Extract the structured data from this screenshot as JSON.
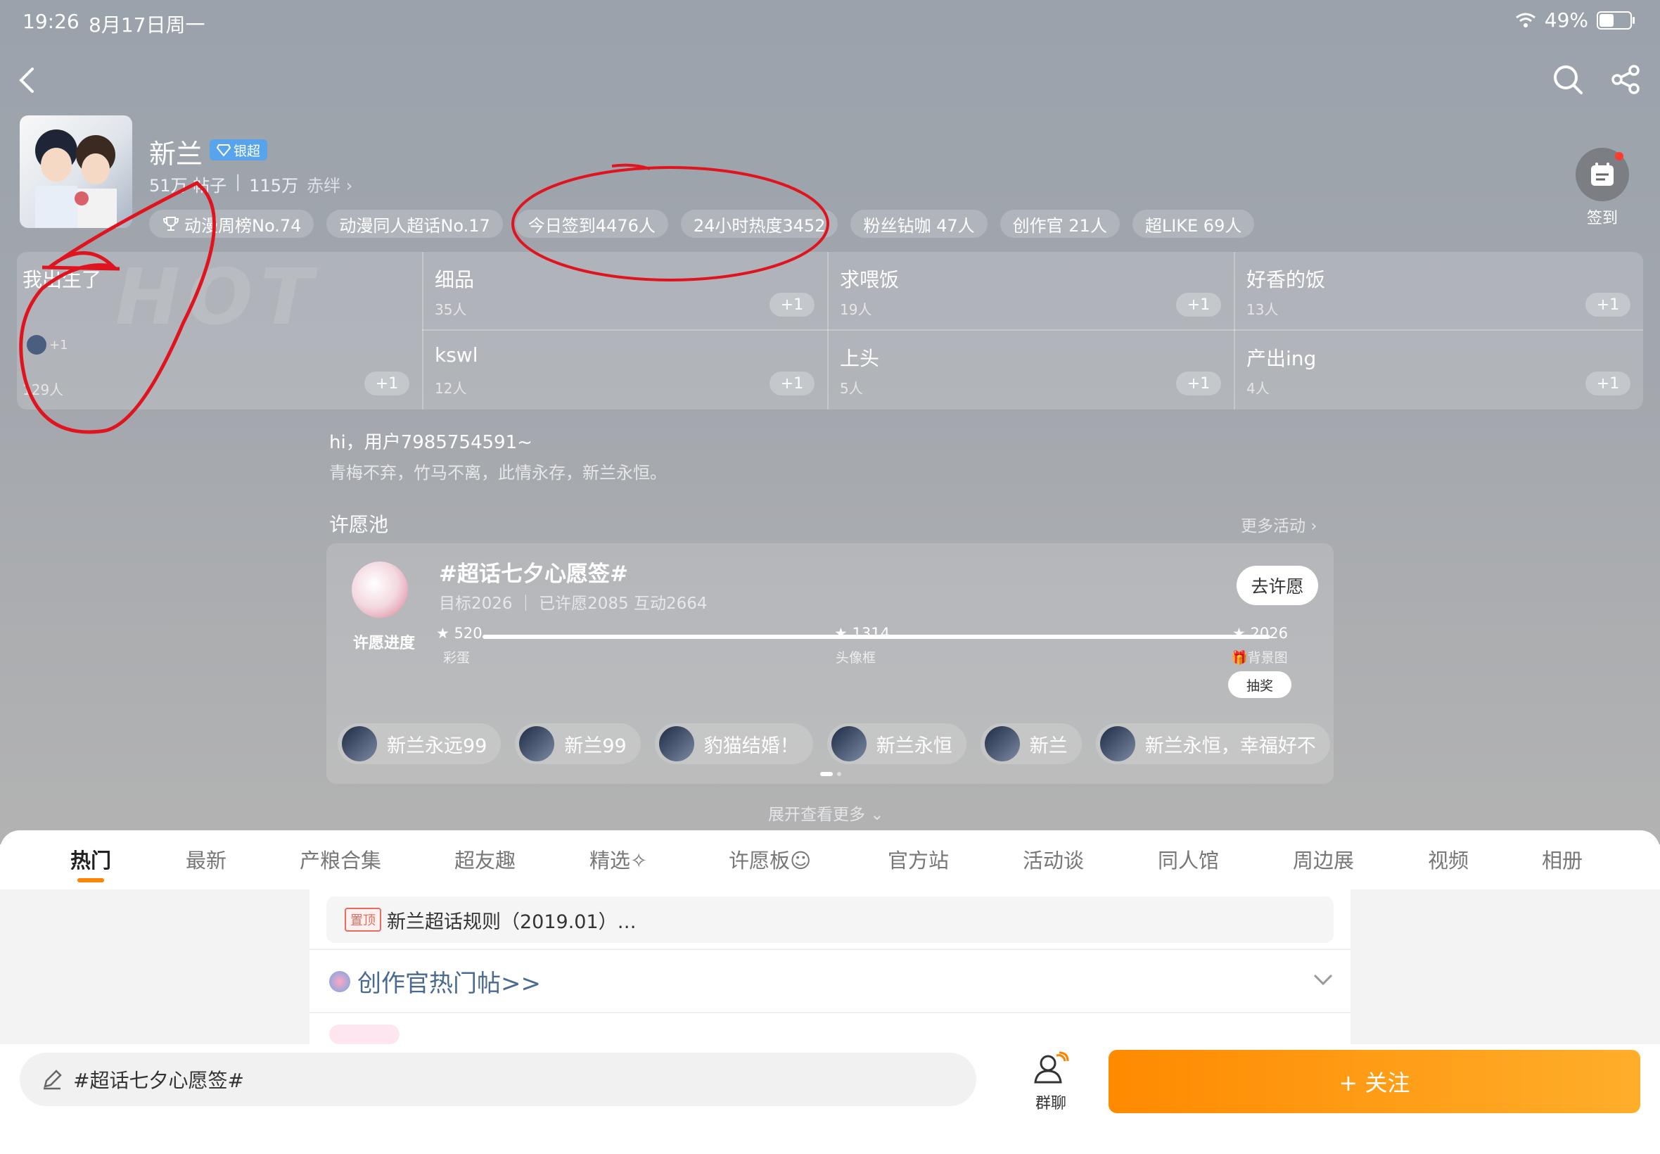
{
  "status_bar": {
    "time": "19:26",
    "date": "8月17日周一",
    "battery": "49%",
    "battery_level": 0.49
  },
  "header": {
    "title": "新兰",
    "badge": "银超",
    "stats": {
      "posts": "51万 帖子",
      "fans_value": "115万",
      "fans_unit": "赤绊"
    },
    "tags": [
      "动漫周榜No.74",
      "动漫同人超话No.17",
      "今日签到4476人",
      "24小时热度3452",
      "粉丝钻咖 47人",
      "创作官 21人",
      "超LIKE 69人"
    ],
    "signin_label": "签到"
  },
  "reaction_grid": {
    "big": {
      "name": "我出生了",
      "count": "129人",
      "mini_label": "+1",
      "plus": "+1"
    },
    "cells": [
      {
        "name": "细品",
        "count": "35人",
        "plus": "+1"
      },
      {
        "name": "kswl",
        "count": "12人",
        "plus": "+1"
      },
      {
        "name": "求喂饭",
        "count": "19人",
        "plus": "+1"
      },
      {
        "name": "上头",
        "count": "5人",
        "plus": "+1"
      },
      {
        "name": "好香的饭",
        "count": "13人",
        "plus": "+1"
      },
      {
        "name": "产出ing",
        "count": "4人",
        "plus": "+1"
      }
    ]
  },
  "greeting": {
    "hello": "hi，用户7985754591~",
    "motto": "青梅不弃，竹马不离，此情永存，新兰永恒。"
  },
  "wish_pool": {
    "section_title": "许愿池",
    "more_label": "更多活动",
    "title": "#超话七夕心愿签#",
    "subtitle": "目标2026 ｜ 已许愿2085 互动2664",
    "go_button": "去许愿",
    "progress_label": "许愿进度",
    "milestones": [
      {
        "value": "520",
        "reward": "彩蛋"
      },
      {
        "value": "1314",
        "reward": "头像框"
      },
      {
        "value": "2026",
        "reward": "背景图"
      }
    ],
    "lottery_button": "抽奖",
    "wishers": [
      "新兰永远99",
      "新兰99",
      "豹猫结婚！",
      "新兰永恒",
      "新兰",
      "新兰永恒，幸福好不"
    ]
  },
  "expand_label": "展开查看更多",
  "tabs": [
    "热门",
    "最新",
    "产粮合集",
    "超友趣",
    "精选",
    "许愿板",
    "官方站",
    "活动谈",
    "同人馆",
    "周边展",
    "视频",
    "相册"
  ],
  "active_tab": 0,
  "feed": {
    "pinned_tag": "置顶",
    "pinned_text": "新兰超话规则（2019.01）…",
    "creator_link": "创作官热门帖>>"
  },
  "bottom_bar": {
    "compose_text": "#超话七夕心愿签#",
    "group_chat": "群聊",
    "follow_button": "+ 关注"
  },
  "colors": {
    "accent": "#ff8200",
    "follow_start": "#ff8a00",
    "follow_end": "#ffae2b",
    "badge": "#57a4ec",
    "annotation": "#e0141e"
  }
}
